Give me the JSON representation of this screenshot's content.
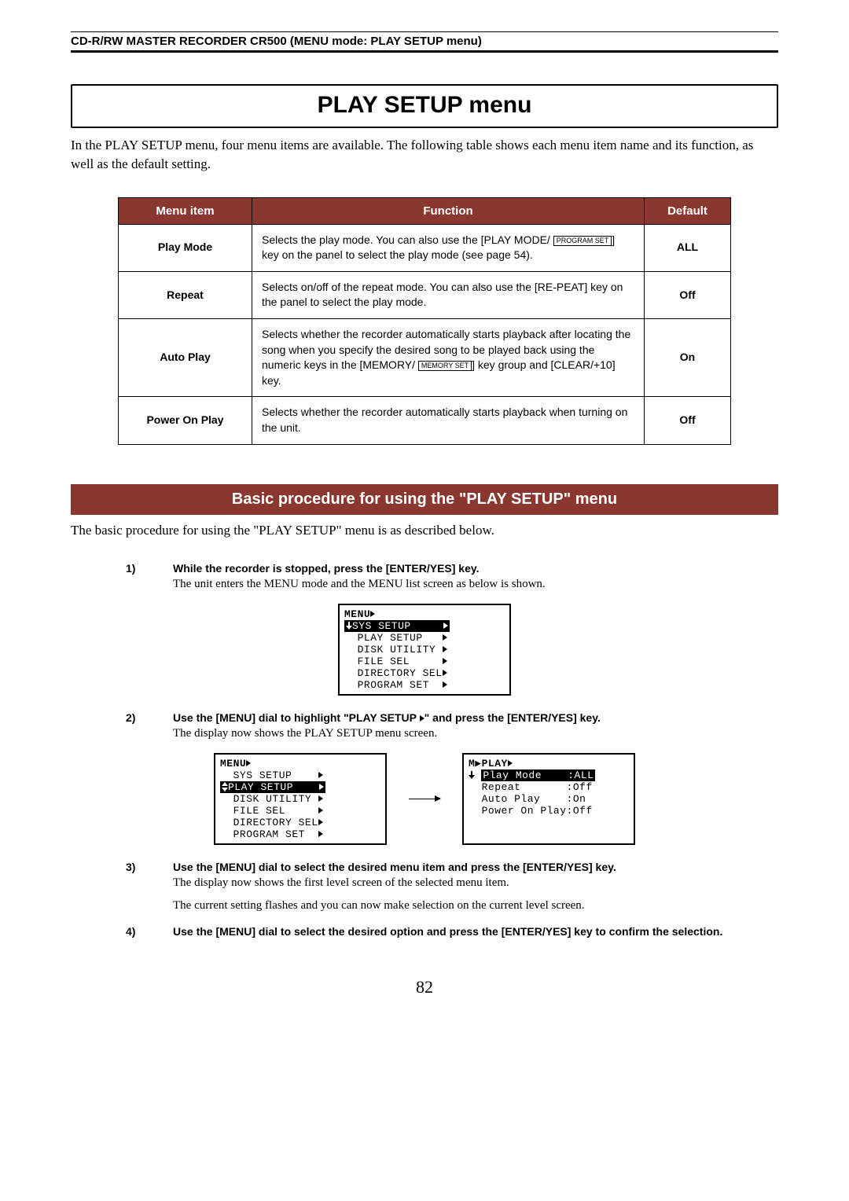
{
  "header": "CD-R/RW MASTER RECORDER  CR500 (MENU mode: PLAY SETUP menu)",
  "title": "PLAY SETUP menu",
  "intro": "In the PLAY SETUP menu, four menu items are available. The following table shows each menu item name and its function, as well as the default setting.",
  "table": {
    "headers": [
      "Menu item",
      "Function",
      "Default"
    ],
    "rows": [
      {
        "item": "Play Mode",
        "func_pre": "Selects the play mode. You can also use the [PLAY MODE/ ",
        "func_key": "PROGRAM SET",
        "func_post": "] key on the panel to select the play mode (see page 54).",
        "default": "ALL"
      },
      {
        "item": "Repeat",
        "func": "Selects on/off of the repeat mode. You can also use the [RE-PEAT] key on the panel to select the play mode.",
        "default": "Off"
      },
      {
        "item": "Auto Play",
        "func_pre": "Selects whether the recorder automatically starts playback after locating the song when you specify the desired song to be played back using the numeric keys in the [MEMORY/ ",
        "func_key": "MEMORY SET",
        "func_post": "] key group and [CLEAR/+10] key.",
        "default": "On"
      },
      {
        "item": "Power On Play",
        "func": "Selects whether the recorder automatically starts playback when turning on the unit.",
        "default": "Off"
      }
    ]
  },
  "section_title": "Basic procedure for using the \"PLAY SETUP\" menu",
  "section_intro": "The basic procedure for using the \"PLAY SETUP\" menu is as described below.",
  "steps": [
    {
      "n": "1)",
      "bold": "While the recorder is stopped, press the [ENTER/YES] key.",
      "desc": "The unit enters the MENU mode and the MENU list screen as below is shown."
    },
    {
      "n": "2)",
      "bold_pre": "Use the [MENU] dial to highlight \"PLAY SETUP ",
      "bold_post": "\" and press the [ENTER/YES] key.",
      "desc": "The display now shows the PLAY SETUP menu screen."
    },
    {
      "n": "3)",
      "bold": "Use the [MENU] dial to select the desired menu item and press the [ENTER/YES] key.",
      "desc": "The display now shows the first level screen of the selected menu item.",
      "desc2": "The current setting flashes and you can now make selection on the current level screen."
    },
    {
      "n": "4)",
      "bold": "Use the [MENU] dial to select the desired option and press the [ENTER/YES] key to confirm the selection."
    }
  ],
  "lcd1": {
    "title": "MENU",
    "sel": "SYS SETUP",
    "items": [
      "PLAY SETUP",
      "DISK UTILITY",
      "FILE SEL",
      "DIRECTORY SEL",
      "PROGRAM SET"
    ]
  },
  "lcd2_left": {
    "title": "MENU",
    "top": "SYS SETUP",
    "sel": "PLAY SETUP",
    "items": [
      "DISK UTILITY",
      "FILE SEL",
      "DIRECTORY SEL",
      "PROGRAM SET"
    ]
  },
  "lcd2_right": {
    "title": "M▶PLAY",
    "rows": [
      {
        "label": "Play Mode",
        "val": "ALL",
        "sel": true
      },
      {
        "label": "Repeat",
        "val": "Off"
      },
      {
        "label": "Auto Play",
        "val": "On"
      },
      {
        "label": "Power On Play",
        "val": "Off"
      }
    ]
  },
  "page_number": "82"
}
